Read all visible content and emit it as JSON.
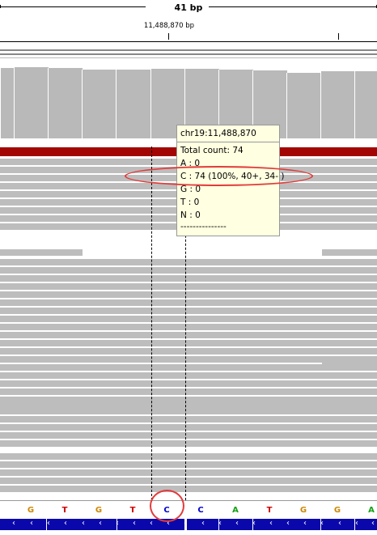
{
  "ruler": {
    "span_label": "41 bp",
    "coord_label": "11,488,870 bp"
  },
  "tooltip": {
    "header": "chr19:11,488,870",
    "lines": [
      "Total count: 74",
      "A : 0",
      "C : 74 (100%, 40+, 34- )",
      "G : 0",
      "T : 0",
      "N : 0",
      "---------------"
    ]
  },
  "sequence": {
    "bases": [
      "G",
      "T",
      "G",
      "T",
      "C",
      "C",
      "A",
      "T",
      "G",
      "G",
      "A"
    ],
    "colors": {
      "A": "#14a014",
      "C": "#0000cc",
      "G": "#cc8800",
      "T": "#cc0000"
    }
  },
  "gene": {
    "strand_glyph": "‹"
  },
  "colors": {
    "coverage": "#b9b9b9",
    "read": "#bdbdbd",
    "red_bar": "#a30404",
    "gene": "#0a08ab",
    "highlight": "#e23b3b"
  }
}
